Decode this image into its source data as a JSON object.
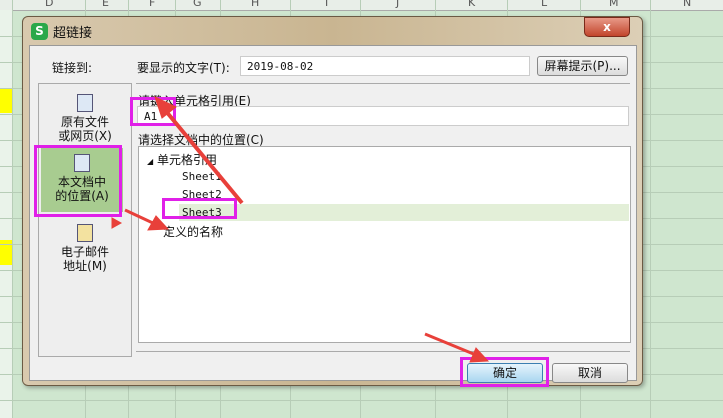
{
  "sheet": {
    "columns": [
      "D",
      "E",
      "F",
      "G",
      "H",
      "I",
      "J",
      "K",
      "L",
      "M",
      "N"
    ]
  },
  "dialog": {
    "title": "超链接",
    "close_label": "x",
    "link_to_label": "链接到:",
    "display_text_label": "要显示的文字(T):",
    "display_text_value": "2019-08-02",
    "screen_tip_button": "屏幕提示(P)...",
    "cell_ref_label": "请键入单元格引用(E)",
    "cell_ref_value": "A1",
    "location_label": "请选择文档中的位置(C)",
    "left_items": [
      {
        "line1": "原有文件",
        "line2": "或网页(X)"
      },
      {
        "line1": "本文档中",
        "line2": "的位置(A)"
      },
      {
        "line1": "电子邮件",
        "line2": "地址(M)"
      }
    ],
    "tree": {
      "root": "单元格引用",
      "sheets": [
        "Sheet1",
        "Sheet2",
        "Sheet3"
      ],
      "selected": "Sheet3",
      "defined_names": "定义的名称"
    },
    "ok_button": "确定",
    "cancel_button": "取消"
  },
  "colors": {
    "highlight": "#e020e8",
    "arrow": "#e8403a",
    "selected_item": "#a8cc90"
  }
}
